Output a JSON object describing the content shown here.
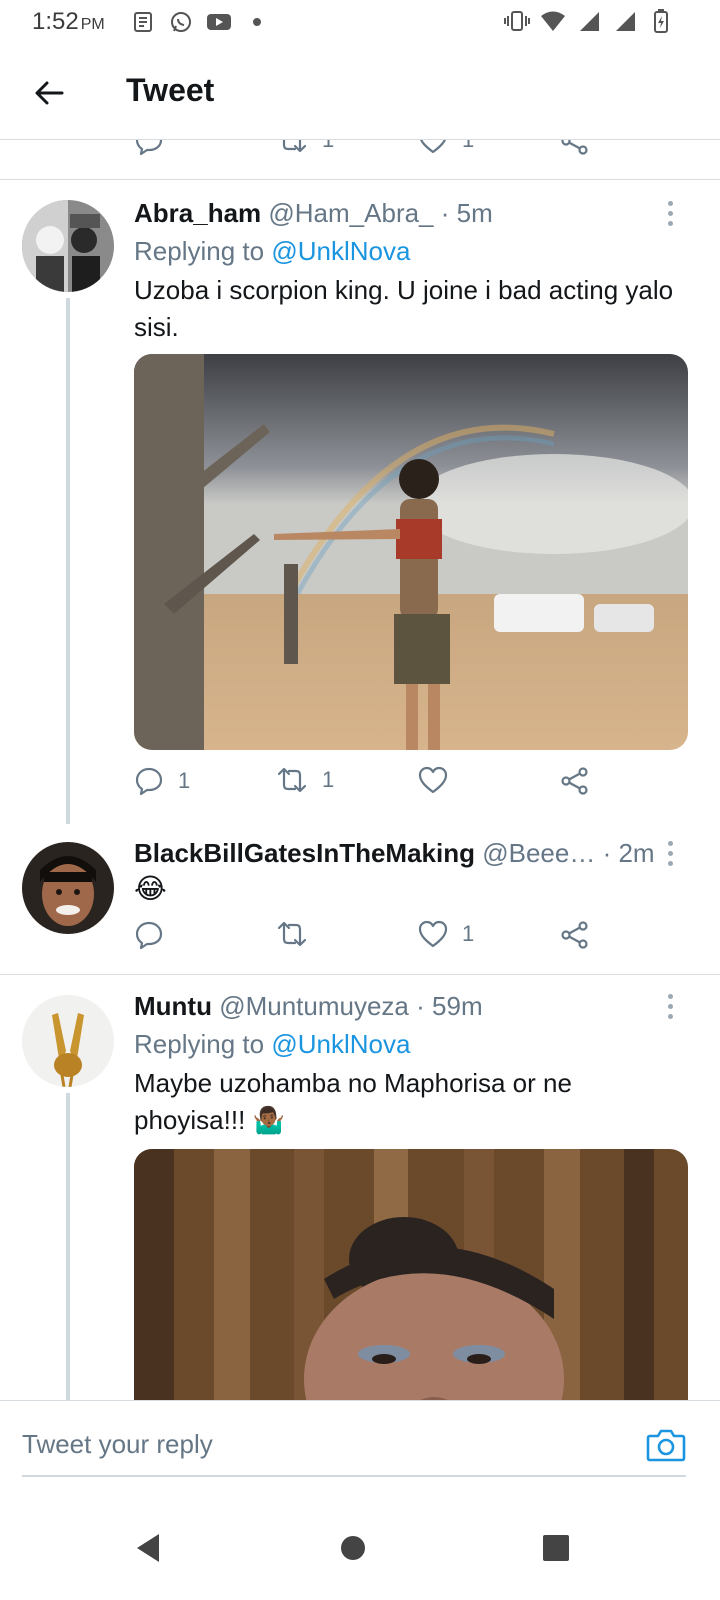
{
  "status_bar": {
    "time": "1:52",
    "ampm": "PM"
  },
  "header": {
    "title": "Tweet"
  },
  "clipped_actions": {
    "retweets": "1",
    "likes": "1"
  },
  "tweets": [
    {
      "name": "Abra_ham",
      "handle": "@Ham_Abra_",
      "time": "· 5m",
      "replying_label": "Replying to",
      "replying_handle": "@UnklNova",
      "text": "Uzoba i scorpion king. U joine i bad acting yalo sisi.",
      "replies": "1",
      "retweets": "1",
      "likes": ""
    },
    {
      "name": "BlackBillGatesInTheMaking",
      "handle": "@Beee…",
      "time": "· 2m",
      "text": "😂",
      "replies": "",
      "retweets": "",
      "likes": "1"
    },
    {
      "name": "Muntu",
      "handle": "@Muntumuyeza",
      "time": "· 59m",
      "replying_label": "Replying to",
      "replying_handle": "@UnklNova",
      "text": "Maybe uzohamba no Maphorisa or ne phoyisa!!! 🤷🏾‍♂️"
    }
  ],
  "reply_bar": {
    "placeholder": "Tweet your reply"
  },
  "colors": {
    "accent": "#1b95e0",
    "secondary_text": "#657786",
    "divider": "#d8dde2"
  },
  "icons": [
    "back-arrow-icon",
    "reply-icon",
    "retweet-icon",
    "like-icon",
    "share-icon",
    "more-vertical-icon",
    "camera-icon",
    "nav-back-icon",
    "nav-home-icon",
    "nav-recents-icon"
  ]
}
